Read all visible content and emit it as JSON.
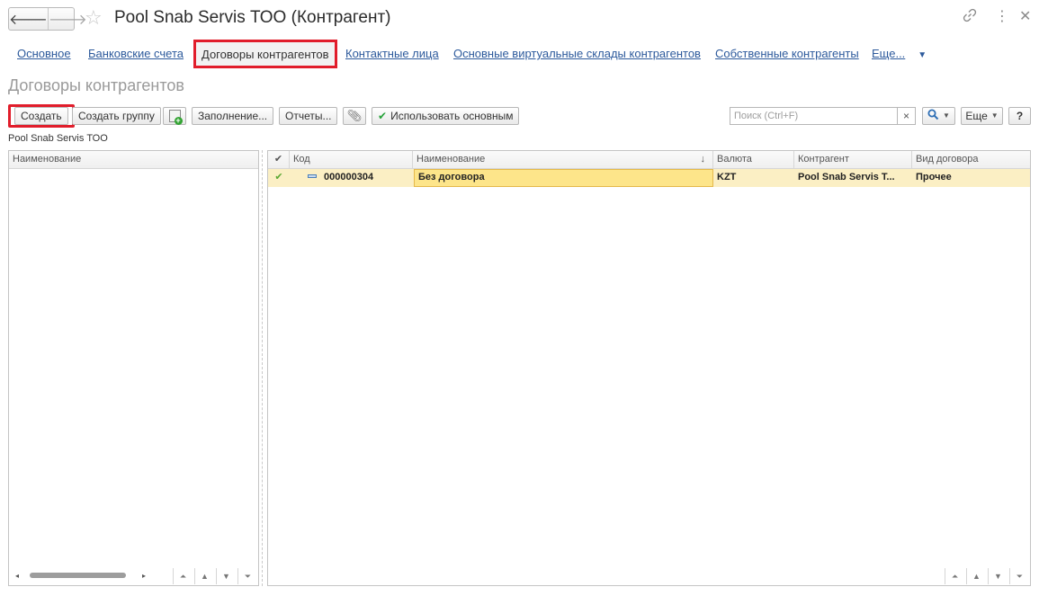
{
  "header": {
    "back_icon": "arrow-left-icon",
    "forward_icon": "arrow-right-icon",
    "favorite_icon": "star-icon",
    "title": "Pool Snab Servis ТОО (Контрагент)",
    "link_icon": "link-icon",
    "more_icon": "vertical-dots-icon",
    "close_icon": "close-icon"
  },
  "tabs": [
    {
      "label": "Основное"
    },
    {
      "label": "Банковские счета"
    },
    {
      "label": "Договоры контрагентов",
      "active": true
    },
    {
      "label": "Контактные лица"
    },
    {
      "label": "Основные виртуальные склады контрагентов"
    },
    {
      "label": "Собственные контрагенты"
    },
    {
      "label": "Еще..."
    }
  ],
  "section_title": "Договоры контрагентов",
  "toolbar": {
    "create": "Создать",
    "create_group": "Создать группу",
    "fill": "Заполнение...",
    "reports": "Отчеты...",
    "use_main": "Использовать основным",
    "search_placeholder": "Поиск (Ctrl+F)",
    "clear": "×",
    "more": "Еще",
    "help": "?"
  },
  "owner_label": "Pool Snab Servis ТОО",
  "left_grid": {
    "header": "Наименование"
  },
  "grid": {
    "columns": [
      "Код",
      "Наименование",
      "Валюта",
      "Контрагент",
      "Вид договора"
    ],
    "sort_indicator": "↓",
    "rows": [
      {
        "code": "000000304",
        "name": "Без договора",
        "currency": "KZT",
        "counterparty": "Pool Snab Servis Т...",
        "contract_type": "Прочее"
      }
    ]
  },
  "colors": {
    "accent_link": "#2d5a9c",
    "highlight_border": "#e11d2b",
    "selected_row": "#fbefc4",
    "check_green": "#27a33a"
  }
}
